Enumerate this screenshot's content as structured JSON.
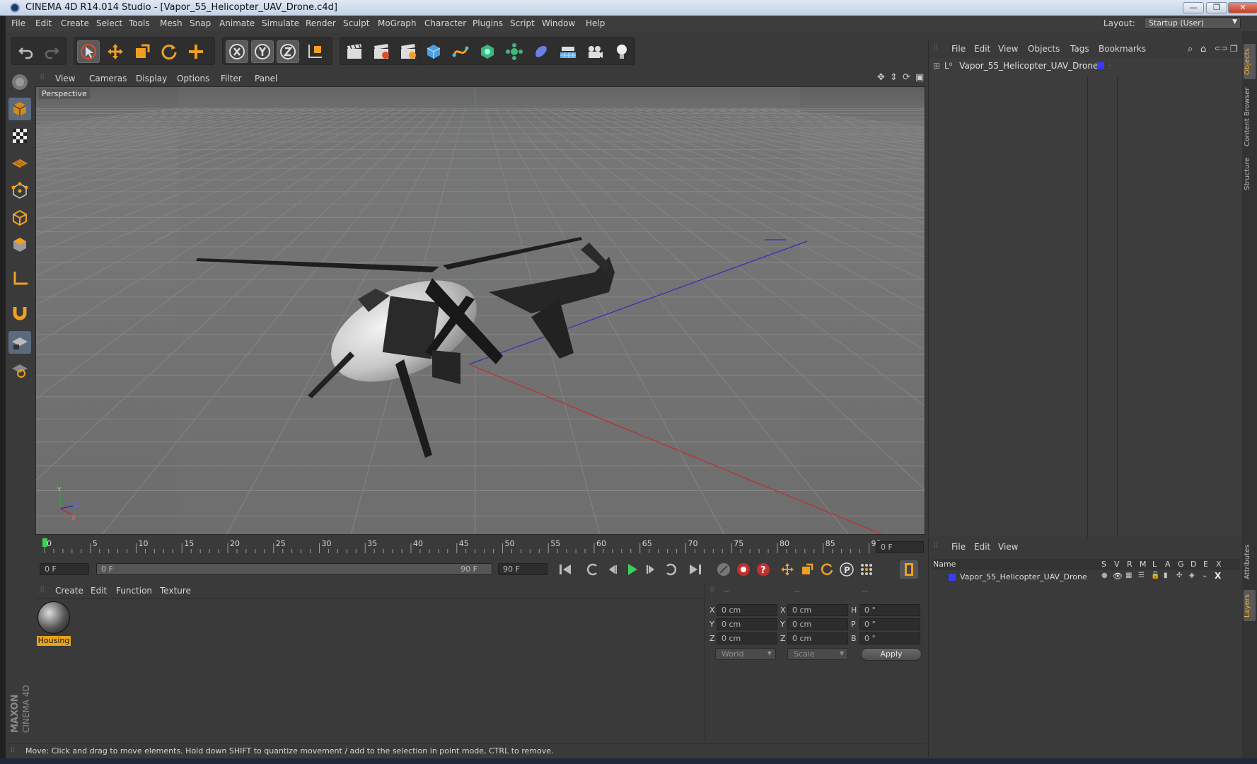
{
  "window": {
    "title": "CINEMA 4D R14.014 Studio - [Vapor_55_Helicopter_UAV_Drone.c4d]",
    "minimize": "—",
    "restore": "❐",
    "close": "✕"
  },
  "menubar": {
    "items": [
      "File",
      "Edit",
      "Create",
      "Select",
      "Tools",
      "Mesh",
      "Snap",
      "Animate",
      "Simulate",
      "Render",
      "Sculpt",
      "MoGraph",
      "Character",
      "Plugins",
      "Script",
      "Window",
      "Help"
    ],
    "layout_label": "Layout:",
    "layout_value": "Startup (User)"
  },
  "viewport": {
    "menu": [
      "View",
      "Cameras",
      "Display",
      "Options",
      "Filter",
      "Panel"
    ],
    "label": "Perspective",
    "axis_labels": {
      "y": "Y",
      "z": "Z",
      "x": "X"
    }
  },
  "timeline": {
    "ticks": [
      "0",
      "5",
      "10",
      "15",
      "20",
      "25",
      "30",
      "35",
      "40",
      "45",
      "50",
      "55",
      "60",
      "65",
      "70",
      "75",
      "80",
      "85",
      "90"
    ],
    "current_frame_field": "0 F",
    "start_field": "0 F",
    "range_start": "0 F",
    "range_end": "90 F",
    "end_field": "90 F"
  },
  "material_manager": {
    "menu": [
      "Create",
      "Edit",
      "Function",
      "Texture"
    ],
    "material_name": "Housing"
  },
  "coordinates": {
    "headers": [
      "--",
      "--",
      "--"
    ],
    "rows": [
      {
        "pos_label": "X",
        "pos_value": "0 cm",
        "size_label": "X",
        "size_value": "0 cm",
        "rot_label": "H",
        "rot_value": "0 °"
      },
      {
        "pos_label": "Y",
        "pos_value": "0 cm",
        "size_label": "Y",
        "size_value": "0 cm",
        "rot_label": "P",
        "rot_value": "0 °"
      },
      {
        "pos_label": "Z",
        "pos_value": "0 cm",
        "size_label": "Z",
        "size_value": "0 cm",
        "rot_label": "B",
        "rot_value": "0 °"
      }
    ],
    "mode_dropdown": "World",
    "scale_dropdown": "Scale",
    "apply_label": "Apply"
  },
  "status_bar": {
    "text": "Move: Click and drag to move elements. Hold down SHIFT to quantize movement / add to the selection in point mode, CTRL to remove."
  },
  "object_manager": {
    "menu": [
      "File",
      "Edit",
      "View",
      "Objects",
      "Tags",
      "Bookmarks"
    ],
    "objects": [
      {
        "name": "Vapor_55_Helicopter_UAV_Drone",
        "color": "#3a3aff"
      }
    ]
  },
  "layer_manager": {
    "menu": [
      "File",
      "Edit",
      "View"
    ],
    "header": {
      "name": "Name",
      "flags": [
        "S",
        "V",
        "R",
        "M",
        "L",
        "A",
        "G",
        "D",
        "E",
        "X"
      ]
    },
    "layers": [
      {
        "name": "Vapor_55_Helicopter_UAV_Drone",
        "color": "#3a3aff"
      }
    ]
  },
  "side_tabs": [
    "Objects",
    "Content Browser",
    "Structure",
    "Attributes",
    "Layers"
  ],
  "branding": {
    "maxon": "MAXON",
    "cinema": "CINEMA 4D"
  }
}
